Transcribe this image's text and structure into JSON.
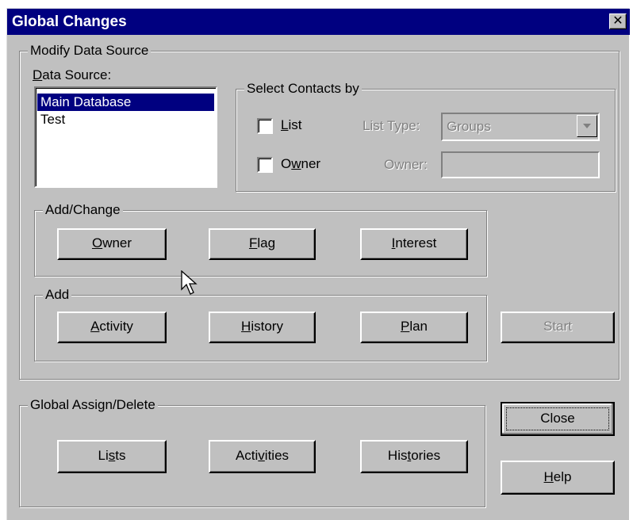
{
  "window": {
    "title": "Global Changes",
    "close_glyph": "✕"
  },
  "modify": {
    "legend": "Modify Data Source",
    "data_source_label": "Data Source:",
    "data_sources": [
      {
        "label": "Main Database",
        "selected": true
      },
      {
        "label": "Test",
        "selected": false
      }
    ]
  },
  "select_contacts": {
    "legend": "Select Contacts by",
    "list_label": "List",
    "owner_label": "Owner",
    "list_type_label": "List Type:",
    "list_type_value": "Groups",
    "owner_field_label": "Owner:",
    "owner_field_value": ""
  },
  "add_change": {
    "legend": "Add/Change",
    "owner_button": "Owner",
    "flag_button": "Flag",
    "interest_button": "Interest"
  },
  "add": {
    "legend": "Add",
    "activity_button": "Activity",
    "history_button": "History",
    "plan_button": "Plan"
  },
  "start_button": "Start",
  "global_assign": {
    "legend": "Global Assign/Delete",
    "lists_button": "Lists",
    "activities_button": "Activities",
    "histories_button": "Histories"
  },
  "close_button": "Close",
  "help_button": "Help",
  "colors": {
    "title_bar": "#000080",
    "face": "#c0c0c0",
    "selection": "#000080"
  },
  "icons": [
    "close-icon",
    "dropdown-arrow-icon",
    "mouse-cursor-icon"
  ]
}
